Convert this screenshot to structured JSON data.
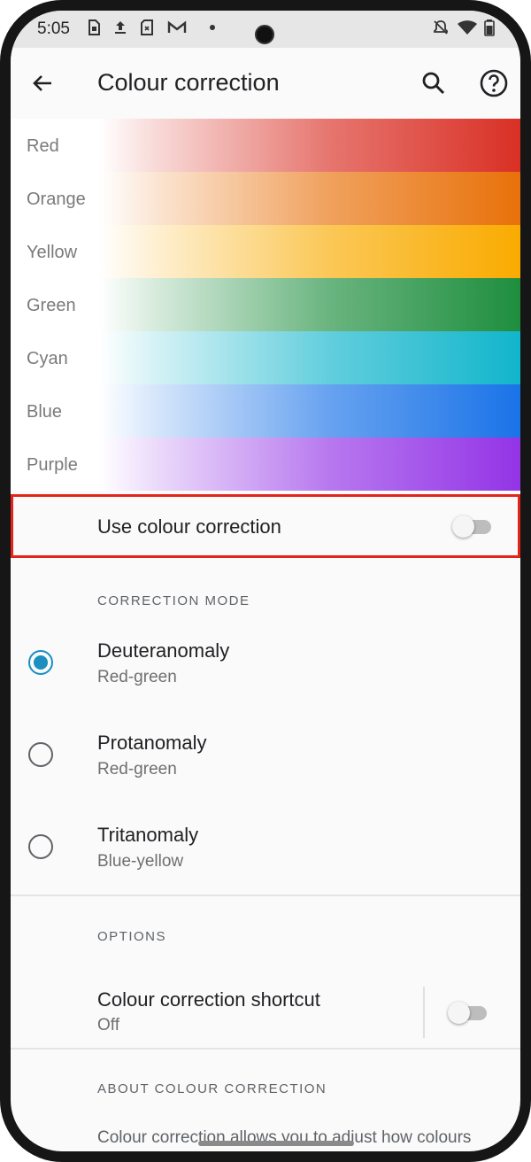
{
  "status_bar": {
    "time": "5:05",
    "left_icons": [
      "sim-card-icon",
      "upload-icon",
      "sd-card-icon",
      "gmail-icon",
      "dot-icon"
    ],
    "right_icons": [
      "notifications-off-icon",
      "wifi-icon",
      "battery-icon"
    ]
  },
  "app_bar": {
    "title": "Colour correction",
    "icons": [
      "back-arrow-icon",
      "search-icon",
      "help-icon"
    ]
  },
  "preview": {
    "rows": [
      {
        "label": "Red",
        "color": "#d93025"
      },
      {
        "label": "Orange",
        "color": "#e8710a"
      },
      {
        "label": "Yellow",
        "color": "#f9ab00"
      },
      {
        "label": "Green",
        "color": "#1e8e3e"
      },
      {
        "label": "Cyan",
        "color": "#12b5cb"
      },
      {
        "label": "Blue",
        "color": "#1a73e8"
      },
      {
        "label": "Purple",
        "color": "#9334e6"
      }
    ]
  },
  "use_correction": {
    "label": "Use colour correction",
    "enabled": false
  },
  "correction_mode": {
    "header": "CORRECTION MODE",
    "options": [
      {
        "title": "Deuteranomaly",
        "subtitle": "Red-green",
        "selected": true
      },
      {
        "title": "Protanomaly",
        "subtitle": "Red-green",
        "selected": false
      },
      {
        "title": "Tritanomaly",
        "subtitle": "Blue-yellow",
        "selected": false
      }
    ]
  },
  "options": {
    "header": "OPTIONS",
    "shortcut_title": "Colour correction shortcut",
    "shortcut_status": "Off",
    "shortcut_enabled": false
  },
  "about": {
    "header": "ABOUT COLOUR CORRECTION",
    "text": "Colour correction allows you to adjust how colours"
  },
  "colors": {
    "accent": "#1a8fc0",
    "highlight_border": "#e3241b"
  }
}
